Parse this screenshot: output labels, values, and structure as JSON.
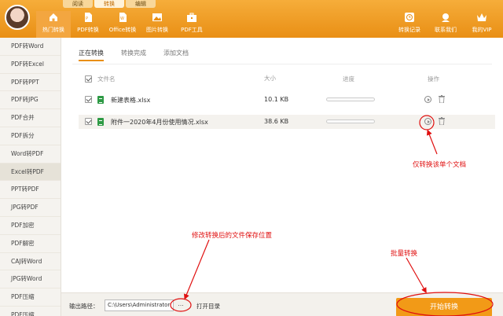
{
  "top_tabs": [
    "阅读",
    "转换",
    "编辑"
  ],
  "nav": [
    {
      "label": "热门转换",
      "icon": "home-icon"
    },
    {
      "label": "PDF转换",
      "icon": "pdf-file-icon"
    },
    {
      "label": "Office转换",
      "icon": "word-file-icon"
    },
    {
      "label": "图片转换",
      "icon": "image-icon"
    },
    {
      "label": "PDF工具",
      "icon": "toolbox-icon"
    }
  ],
  "right_nav": [
    {
      "label": "转换记录",
      "icon": "clock-icon"
    },
    {
      "label": "联系我们",
      "icon": "headset-icon"
    },
    {
      "label": "我的VIP",
      "icon": "crown-icon"
    }
  ],
  "sidebar": [
    "PDF转Word",
    "PDF转Excel",
    "PDF转PPT",
    "PDF转JPG",
    "PDF合并",
    "PDF拆分",
    "Word转PDF",
    "Excel转PDF",
    "PPT转PDF",
    "JPG转PDF",
    "PDF加密",
    "PDF解密",
    "CAJ转Word",
    "JPG转Word",
    "PDF压缩",
    "PDF压缩"
  ],
  "sidebar_active_index": 7,
  "sub_tabs": [
    "正在转换",
    "转换完成",
    "添加文档"
  ],
  "columns": {
    "name": "文件名",
    "size": "大小",
    "progress": "进度",
    "action": "操作"
  },
  "files": [
    {
      "name": "新建表格.xlsx",
      "size": "10.1 KB",
      "checked": true,
      "progress": 0
    },
    {
      "name": "附件一2020年4月份使用情况.xlsx",
      "size": "38.6 KB",
      "checked": true,
      "progress": 0
    }
  ],
  "bottom": {
    "output_label": "输出路径：",
    "path_value": "C:\\Users\\Administrator",
    "browse_label": "...",
    "open_dir_label": "打开目录",
    "start_label": "开始转换"
  },
  "annotations": {
    "single": "仅转换该单个文档",
    "save_path": "修改转换后的文件保存位置",
    "batch": "批量转换"
  },
  "colors": {
    "accent": "#e98f15",
    "annotation": "#e01010",
    "excel_green": "#2e9a45"
  }
}
